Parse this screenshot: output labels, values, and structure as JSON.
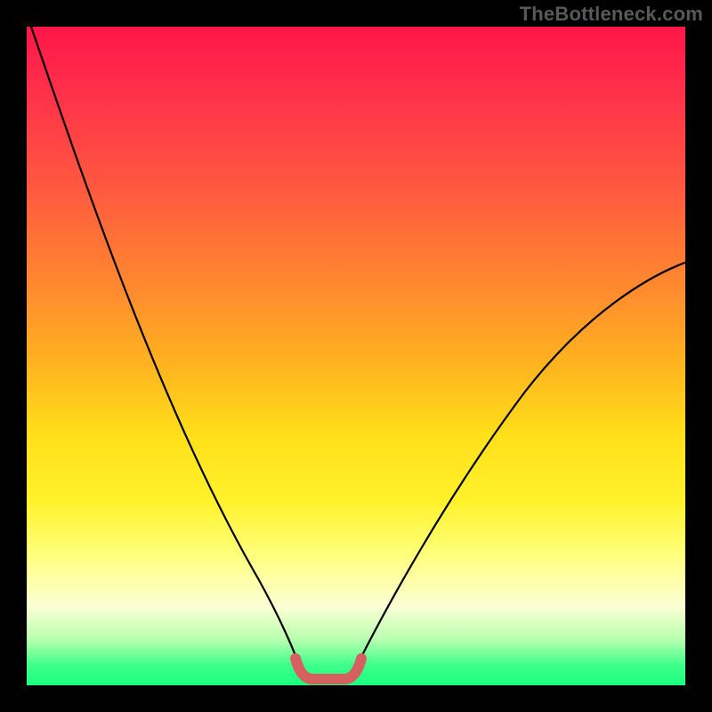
{
  "watermark": "TheBottleneck.com",
  "colors": {
    "frame_bg": "#000000",
    "curve_stroke": "#000000",
    "flat_stroke": "#d66060"
  },
  "chart_data": {
    "type": "line",
    "title": "",
    "xlabel": "",
    "ylabel": "",
    "xlim": [
      0,
      100
    ],
    "ylim": [
      0,
      100
    ],
    "series": [
      {
        "name": "left-curve",
        "x": [
          0,
          5,
          10,
          15,
          20,
          25,
          30,
          35,
          39,
          41
        ],
        "values": [
          100,
          91,
          80,
          68,
          56,
          44,
          32,
          20,
          9,
          3
        ]
      },
      {
        "name": "right-curve",
        "x": [
          50,
          52,
          56,
          62,
          70,
          78,
          86,
          94,
          100
        ],
        "values": [
          3,
          7,
          14,
          24,
          35,
          45,
          53,
          60,
          64
        ]
      },
      {
        "name": "flat-red-segment",
        "x": [
          41,
          42,
          43,
          48,
          49,
          50
        ],
        "values": [
          3,
          1,
          0.5,
          0.5,
          1,
          3
        ]
      }
    ],
    "note": "y values are relative (0 = bottom/green, 100 = top/red); no numeric axes are rendered in the image"
  }
}
